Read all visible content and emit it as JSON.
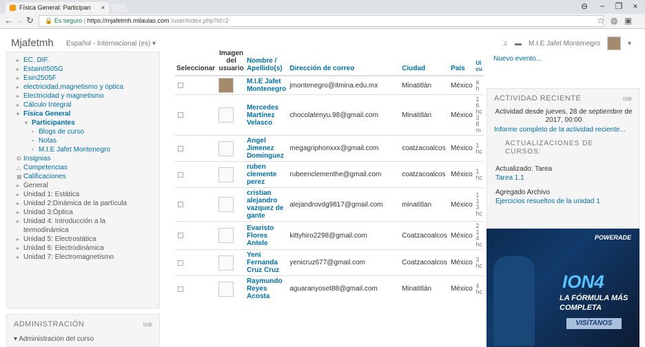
{
  "browser": {
    "tab_title": "Física General: Participan",
    "tab_close": "×",
    "win_buttons": [
      "⊖",
      "−",
      "❐",
      "×"
    ],
    "omnibox": {
      "secure_label": "Es seguro",
      "separator": " | ",
      "host": "https://mjafetmh.milaulas.com",
      "path": "/user/index.php?id=2"
    }
  },
  "header": {
    "brand": "Mjafetmh",
    "language": "Español - Internacional (es) ▾",
    "user_name": "M.I.E Jafet Montenegro"
  },
  "left_nav": {
    "items": [
      {
        "label": "EC. DIF.",
        "indent": 0,
        "arrow": "▸"
      },
      {
        "label": "EstainII505G",
        "indent": 0,
        "arrow": "▸"
      },
      {
        "label": "Esin2505F",
        "indent": 0,
        "arrow": "▸"
      },
      {
        "label": "electricidad,magnetismo y óptica",
        "indent": 0,
        "arrow": "▸"
      },
      {
        "label": "Electricidad y magnetismo",
        "indent": 0,
        "arrow": "▸"
      },
      {
        "label": "Cálculo Integral",
        "indent": 0,
        "arrow": "▸"
      },
      {
        "label": "Física General",
        "indent": 0,
        "arrow": "▾"
      },
      {
        "label": "Participantes",
        "indent": 1,
        "arrow": "▾"
      },
      {
        "label": "Blogs de curso",
        "indent": 2,
        "arrow": "•"
      },
      {
        "label": "Notas",
        "indent": 2,
        "arrow": "•"
      },
      {
        "label": "M.I.E Jafet Montenegro",
        "indent": 2,
        "arrow": "•"
      },
      {
        "label": "Insignias",
        "indent": 0,
        "arrow": "✪"
      },
      {
        "label": "Competencias",
        "indent": 0,
        "arrow": "△"
      },
      {
        "label": "Calificaciones",
        "indent": 0,
        "arrow": "▦"
      },
      {
        "label": "General",
        "indent": 0,
        "arrow": "▸"
      },
      {
        "label": "Unidad 1: Estática",
        "indent": 0,
        "arrow": "▸"
      },
      {
        "label": "Unidad 2:Dinámica de la partícula",
        "indent": 0,
        "arrow": "▸"
      },
      {
        "label": "Unidad 3:Óptica",
        "indent": 0,
        "arrow": "▸"
      },
      {
        "label": "Unidad 4: Introducción a la",
        "indent": 0,
        "arrow": "▸"
      },
      {
        "label": "termodinámica",
        "indent": 0,
        "arrow": ""
      },
      {
        "label": "Unidad 5: Electrostática",
        "indent": 0,
        "arrow": "▸"
      },
      {
        "label": "Unidad 6: Electrodinámica",
        "indent": 0,
        "arrow": "▸"
      },
      {
        "label": "Unidad 7: Electromagnetismo",
        "indent": 0,
        "arrow": "▸"
      }
    ]
  },
  "admin": {
    "title": "ADMINISTRACIÓN",
    "item": "Administración del curso",
    "collapse": "⊟⊞"
  },
  "table": {
    "headers": {
      "select": "Seleccionar",
      "image": "Imagen del usuario",
      "name": "Nombre / Apellido(s)",
      "email": "Dirección de correo",
      "city": "Ciudad",
      "country": "País",
      "last": "Ul cu"
    },
    "rows": [
      {
        "name": "M.I.E Jafet Montenegro",
        "email": "jmontenegro@itmina.edu.mx",
        "city": "Minatitlán",
        "country": "México",
        "last": "ah"
      },
      {
        "name": "Mercedes Martínez Velasco",
        "email": "chocolatenyu.98@gmail.com",
        "city": "Minatitlán",
        "country": "México",
        "last": "16 hc 38 m"
      },
      {
        "name": "Angel Jimenez Dominguez",
        "email": "megagriphonxxx@gmail.com",
        "city": "coatzacoalcos",
        "country": "México",
        "last": "1 hc"
      },
      {
        "name": "ruben clemente perez",
        "email": "rubeenclementhe@gmail.com",
        "city": "coatzacoalcos",
        "country": "México",
        "last": "1 hc"
      },
      {
        "name": "cristian alejandro vazquez de gante",
        "email": "alejandrovdg9817@gmail.com",
        "city": "minatitlan",
        "country": "México",
        "last": "1 13 hc"
      },
      {
        "name": "Evaristo Flores Antele",
        "email": "kittyhiro2298@gmail.com",
        "city": "Coatzacoalcos",
        "country": "México",
        "last": "2 14 hc"
      },
      {
        "name": "Yeni Fernanda Cruz Cruz",
        "email": "yenicruz677@gmail.com",
        "city": "Coatzacoalcos",
        "country": "México",
        "last": "3 hc"
      },
      {
        "name": "Raymundo Reyes Acosta",
        "email": "aguaranyoset88@gmail.com",
        "city": "Minatitlán",
        "country": "México",
        "last": "4 hc"
      }
    ]
  },
  "right": {
    "calendar_new_event": "Nuevo evento...",
    "activity": {
      "title": "ACTIVIDAD RECIENTE",
      "collapse": "⊟⊞",
      "since": "Actividad desde jueves, 28 de septiembre de 2017, 00:00",
      "full_report": "Informe completo de la actividad reciente...",
      "updates_title": "ACTUALIZACIONES DE CURSOS:",
      "update1_label": "Actualizado: Tarea",
      "update1_link": "Tarea 1.1",
      "update2_label": "Agregado Archivo",
      "update2_link": "Ejercicios resueltos de la unidad 1"
    },
    "ad": {
      "brand": "POWERADE",
      "product": "ION4",
      "tagline": "LA FÓRMULA MÁS COMPLETA",
      "cta": "VISÍTANOS"
    }
  }
}
